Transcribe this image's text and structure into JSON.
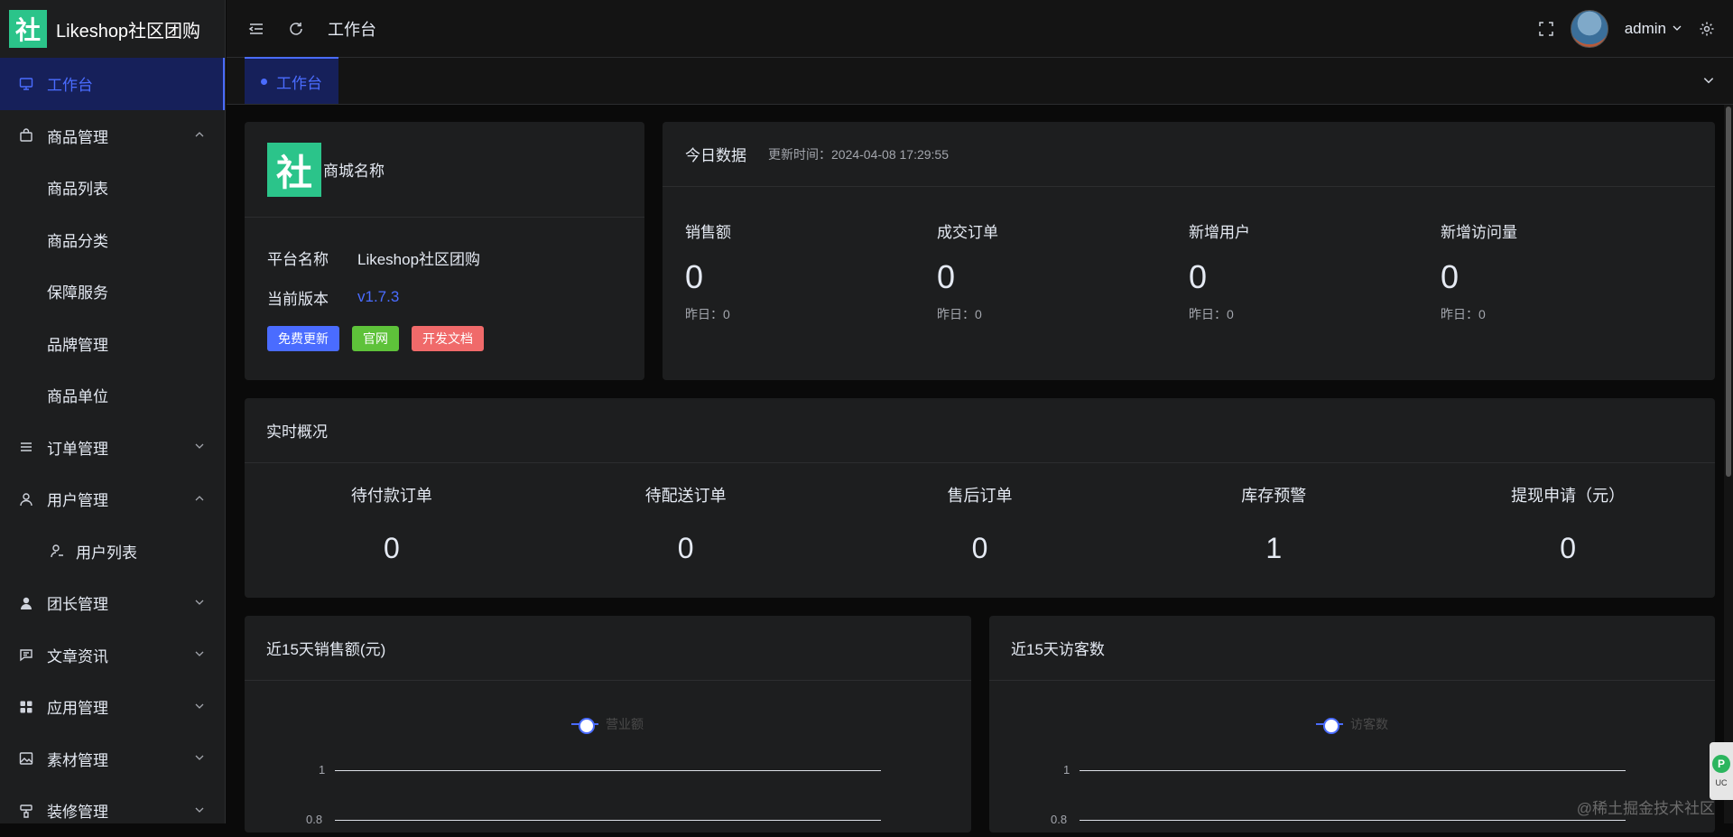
{
  "brand": {
    "logo_char": "社",
    "name": "Likeshop社区团购"
  },
  "colors": {
    "accent": "#4a6cff",
    "logo_green": "#2bc48a"
  },
  "sidebar": {
    "items": [
      {
        "label": "工作台",
        "icon": "monitor-icon",
        "active": true
      },
      {
        "label": "商品管理",
        "icon": "bag-icon",
        "expanded": true,
        "children": [
          "商品列表",
          "商品分类",
          "保障服务",
          "品牌管理",
          "商品单位"
        ]
      },
      {
        "label": "订单管理",
        "icon": "list-icon"
      },
      {
        "label": "用户管理",
        "icon": "user-icon",
        "expanded": true,
        "children": [
          "用户列表"
        ]
      },
      {
        "label": "团长管理",
        "icon": "person-filled-icon"
      },
      {
        "label": "文章资讯",
        "icon": "chat-icon"
      },
      {
        "label": "应用管理",
        "icon": "grid-icon"
      },
      {
        "label": "素材管理",
        "icon": "picture-icon"
      },
      {
        "label": "装修管理",
        "icon": "paint-icon"
      }
    ]
  },
  "header": {
    "title": "工作台",
    "username": "admin"
  },
  "tabs": [
    {
      "label": "工作台",
      "active": true
    }
  ],
  "shop_card": {
    "logo_char": "社",
    "name": "商城名称",
    "platform_label": "平台名称",
    "platform_value": "Likeshop社区团购",
    "version_label": "当前版本",
    "version_value": "v1.7.3",
    "buttons": [
      "免费更新",
      "官网",
      "开发文档"
    ]
  },
  "today": {
    "title": "今日数据",
    "update_time": "更新时间：2024-04-08 17:29:55",
    "stats": [
      {
        "label": "销售额",
        "value": "0",
        "sub": "昨日：0"
      },
      {
        "label": "成交订单",
        "value": "0",
        "sub": "昨日：0"
      },
      {
        "label": "新增用户",
        "value": "0",
        "sub": "昨日：0"
      },
      {
        "label": "新增访问量",
        "value": "0",
        "sub": "昨日：0"
      }
    ]
  },
  "realtime": {
    "title": "实时概况",
    "stats": [
      {
        "label": "待付款订单",
        "value": "0"
      },
      {
        "label": "待配送订单",
        "value": "0"
      },
      {
        "label": "售后订单",
        "value": "0"
      },
      {
        "label": "库存预警",
        "value": "1"
      },
      {
        "label": "提现申请（元）",
        "value": "0"
      }
    ]
  },
  "charts": {
    "sales": {
      "title": "近15天销售额(元)",
      "legend": "营业额",
      "ticks": [
        "1",
        "0.8"
      ]
    },
    "visits": {
      "title": "近15天访客数",
      "legend": "访客数",
      "ticks": [
        "1",
        "0.8"
      ]
    }
  },
  "side_widget": {
    "text": "UC"
  },
  "watermark": "@稀土掘金技术社区"
}
